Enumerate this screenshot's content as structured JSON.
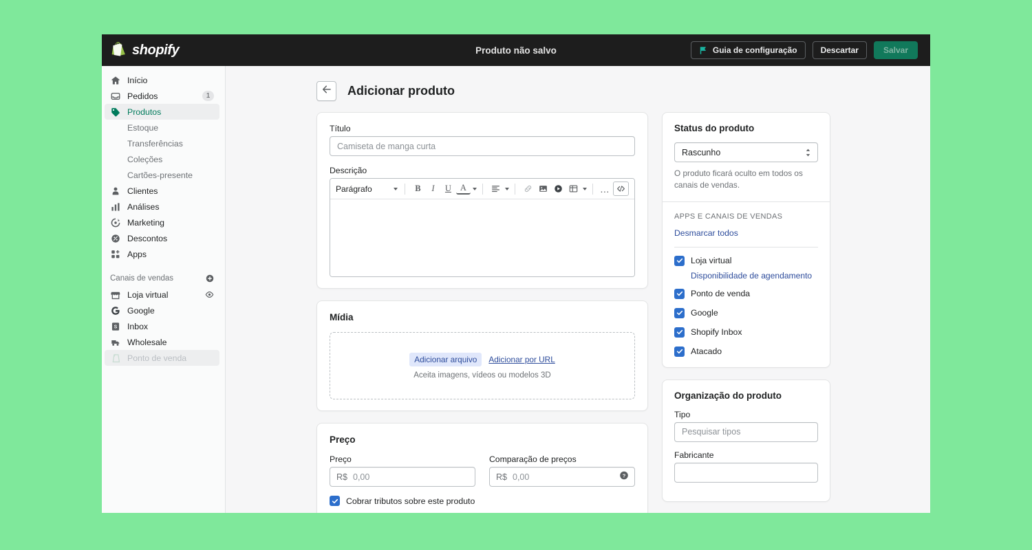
{
  "theme": {
    "page_background": "#7fe89b",
    "topbar_background": "#1d1d1d",
    "accent_green": "#007b5c",
    "accent_blue": "#2c6ecb",
    "link_blue": "#2c4b9b",
    "content_background": "#f6f6f7"
  },
  "topbar": {
    "brand": "shopify",
    "title": "Produto não salvo",
    "setup_guide_label": "Guia de configuração",
    "discard_label": "Descartar",
    "save_label": "Salvar"
  },
  "sidebar": {
    "items": [
      {
        "label": "Início",
        "icon": "home-icon",
        "badge": ""
      },
      {
        "label": "Pedidos",
        "icon": "orders-icon",
        "badge": "1"
      },
      {
        "label": "Produtos",
        "icon": "product-tag-icon",
        "badge": "",
        "active": true
      },
      {
        "label": "Clientes",
        "icon": "customer-icon",
        "badge": ""
      },
      {
        "label": "Análises",
        "icon": "analytics-icon",
        "badge": ""
      },
      {
        "label": "Marketing",
        "icon": "marketing-icon",
        "badge": ""
      },
      {
        "label": "Descontos",
        "icon": "discount-icon",
        "badge": ""
      },
      {
        "label": "Apps",
        "icon": "apps-icon",
        "badge": ""
      }
    ],
    "product_subitems": [
      {
        "label": "Estoque"
      },
      {
        "label": "Transferências"
      },
      {
        "label": "Coleções"
      },
      {
        "label": "Cartões-presente"
      }
    ],
    "sales_channels_heading": "Canais de vendas",
    "sales_channels": [
      {
        "label": "Loja virtual",
        "icon": "storefront-icon",
        "has_eye": true
      },
      {
        "label": "Google",
        "icon": "google-icon"
      },
      {
        "label": "Inbox",
        "icon": "inbox-icon"
      },
      {
        "label": "Wholesale",
        "icon": "wholesale-icon"
      },
      {
        "label": "Ponto de venda",
        "icon": "pos-icon",
        "disabled": true
      }
    ]
  },
  "page": {
    "title": "Adicionar produto"
  },
  "product_form": {
    "title_label": "Título",
    "title_placeholder": "Camiseta de manga curta",
    "title_value": "",
    "description_label": "Descrição",
    "description_value": "",
    "editor_toolbar": {
      "block_format": "Parágrafo",
      "bold": "B",
      "italic": "I",
      "underline": "U",
      "text_color": "A",
      "more": "…",
      "code_view": "</>"
    }
  },
  "media": {
    "title": "Mídia",
    "add_file_label": "Adicionar arquivo",
    "add_url_label": "Adicionar por URL",
    "hint": "Aceita imagens, vídeos ou modelos 3D"
  },
  "pricing": {
    "title": "Preço",
    "price_label": "Preço",
    "price_prefix": "R$",
    "price_placeholder": "0,00",
    "compare_label": "Comparação de preços",
    "compare_prefix": "R$",
    "compare_placeholder": "0,00",
    "tax_checkbox_label": "Cobrar tributos sobre este produto",
    "tax_checked": true
  },
  "status_card": {
    "title": "Status do produto",
    "status_value": "Rascunho",
    "helper": "O produto ficará oculto em todos os canais de vendas.",
    "channels_heading": "APPS E CANAIS DE VENDAS",
    "deselect_all_label": "Desmarcar todos",
    "channels": [
      {
        "label": "Loja virtual",
        "checked": true,
        "sub_link": "Disponibilidade de agendamento"
      },
      {
        "label": "Ponto de venda",
        "checked": true
      },
      {
        "label": "Google",
        "checked": true
      },
      {
        "label": "Shopify Inbox",
        "checked": true
      },
      {
        "label": "Atacado",
        "checked": true
      }
    ]
  },
  "organization_card": {
    "title": "Organização do produto",
    "type_label": "Tipo",
    "type_placeholder": "Pesquisar tipos",
    "type_value": "",
    "vendor_label": "Fabricante",
    "vendor_placeholder": "",
    "vendor_value": ""
  }
}
